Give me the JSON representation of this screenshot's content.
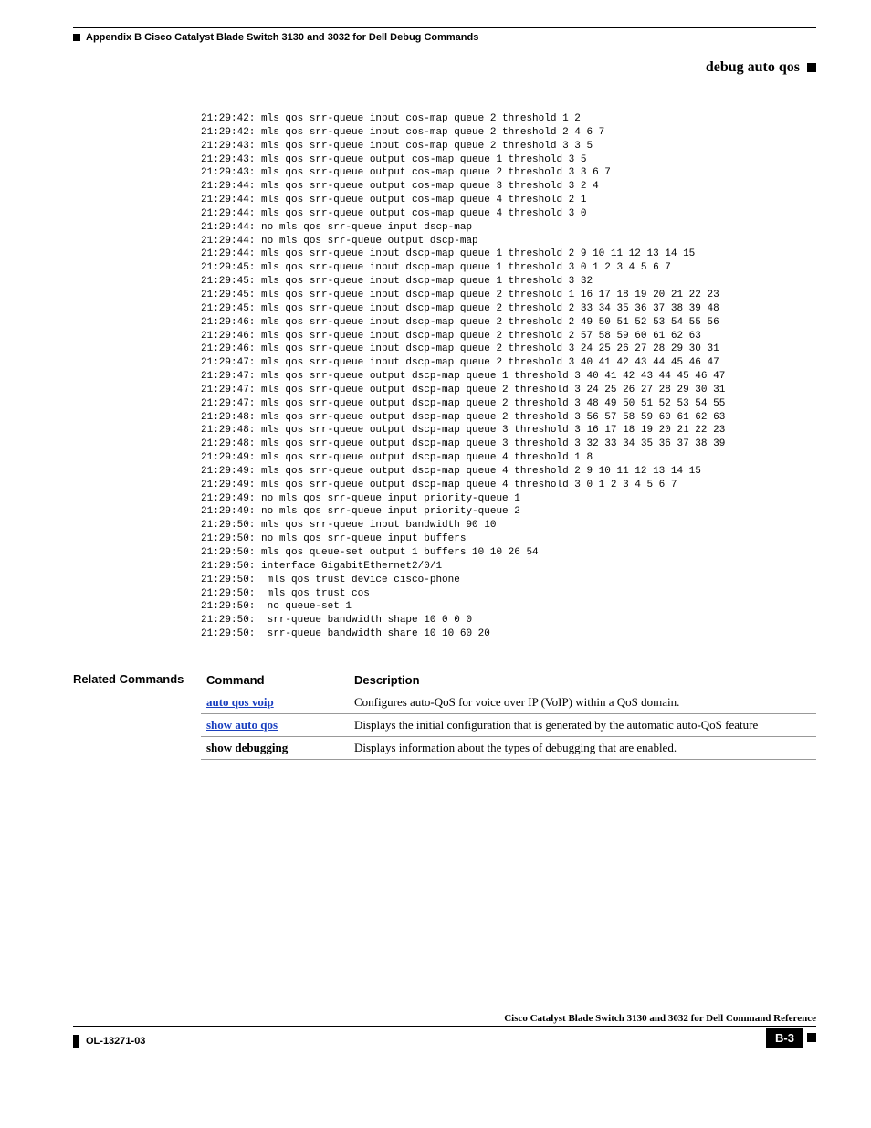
{
  "header": {
    "left": "Appendix B      Cisco Catalyst Blade Switch 3130 and 3032 for Dell Debug Commands",
    "right": "debug auto qos"
  },
  "code_lines": [
    "21:29:42: mls qos srr-queue input cos-map queue 2 threshold 1 2",
    "21:29:42: mls qos srr-queue input cos-map queue 2 threshold 2 4 6 7",
    "21:29:43: mls qos srr-queue input cos-map queue 2 threshold 3 3 5",
    "21:29:43: mls qos srr-queue output cos-map queue 1 threshold 3 5",
    "21:29:43: mls qos srr-queue output cos-map queue 2 threshold 3 3 6 7",
    "21:29:44: mls qos srr-queue output cos-map queue 3 threshold 3 2 4",
    "21:29:44: mls qos srr-queue output cos-map queue 4 threshold 2 1",
    "21:29:44: mls qos srr-queue output cos-map queue 4 threshold 3 0",
    "21:29:44: no mls qos srr-queue input dscp-map",
    "21:29:44: no mls qos srr-queue output dscp-map",
    "21:29:44: mls qos srr-queue input dscp-map queue 1 threshold 2 9 10 11 12 13 14 15",
    "21:29:45: mls qos srr-queue input dscp-map queue 1 threshold 3 0 1 2 3 4 5 6 7",
    "21:29:45: mls qos srr-queue input dscp-map queue 1 threshold 3 32",
    "21:29:45: mls qos srr-queue input dscp-map queue 2 threshold 1 16 17 18 19 20 21 22 23",
    "21:29:45: mls qos srr-queue input dscp-map queue 2 threshold 2 33 34 35 36 37 38 39 48",
    "21:29:46: mls qos srr-queue input dscp-map queue 2 threshold 2 49 50 51 52 53 54 55 56",
    "21:29:46: mls qos srr-queue input dscp-map queue 2 threshold 2 57 58 59 60 61 62 63",
    "21:29:46: mls qos srr-queue input dscp-map queue 2 threshold 3 24 25 26 27 28 29 30 31",
    "21:29:47: mls qos srr-queue input dscp-map queue 2 threshold 3 40 41 42 43 44 45 46 47",
    "21:29:47: mls qos srr-queue output dscp-map queue 1 threshold 3 40 41 42 43 44 45 46 47",
    "21:29:47: mls qos srr-queue output dscp-map queue 2 threshold 3 24 25 26 27 28 29 30 31",
    "21:29:47: mls qos srr-queue output dscp-map queue 2 threshold 3 48 49 50 51 52 53 54 55",
    "21:29:48: mls qos srr-queue output dscp-map queue 2 threshold 3 56 57 58 59 60 61 62 63",
    "21:29:48: mls qos srr-queue output dscp-map queue 3 threshold 3 16 17 18 19 20 21 22 23",
    "21:29:48: mls qos srr-queue output dscp-map queue 3 threshold 3 32 33 34 35 36 37 38 39",
    "21:29:49: mls qos srr-queue output dscp-map queue 4 threshold 1 8",
    "21:29:49: mls qos srr-queue output dscp-map queue 4 threshold 2 9 10 11 12 13 14 15",
    "21:29:49: mls qos srr-queue output dscp-map queue 4 threshold 3 0 1 2 3 4 5 6 7",
    "21:29:49: no mls qos srr-queue input priority-queue 1",
    "21:29:49: no mls qos srr-queue input priority-queue 2",
    "21:29:50: mls qos srr-queue input bandwidth 90 10",
    "21:29:50: no mls qos srr-queue input buffers",
    "21:29:50: mls qos queue-set output 1 buffers 10 10 26 54",
    "21:29:50: interface GigabitEthernet2/0/1",
    "21:29:50:  mls qos trust device cisco-phone",
    "21:29:50:  mls qos trust cos",
    "21:29:50:  no queue-set 1",
    "21:29:50:  srr-queue bandwidth shape 10 0 0 0",
    "21:29:50:  srr-queue bandwidth share 10 10 60 20"
  ],
  "related": {
    "label": "Related Commands",
    "headers": {
      "command": "Command",
      "description": "Description"
    },
    "rows": [
      {
        "cmd": "auto qos voip",
        "link": true,
        "desc": "Configures auto-QoS for voice over IP (VoIP) within a QoS domain."
      },
      {
        "cmd": "show auto qos",
        "link": true,
        "desc": "Displays the initial configuration that is generated by the automatic auto-QoS feature"
      },
      {
        "cmd": "show debugging",
        "link": false,
        "desc": "Displays information about the types of debugging that are enabled."
      }
    ]
  },
  "footer": {
    "left": "OL-13271-03",
    "title": "Cisco Catalyst Blade Switch 3130 and 3032 for Dell Command Reference",
    "page": "B-3"
  }
}
